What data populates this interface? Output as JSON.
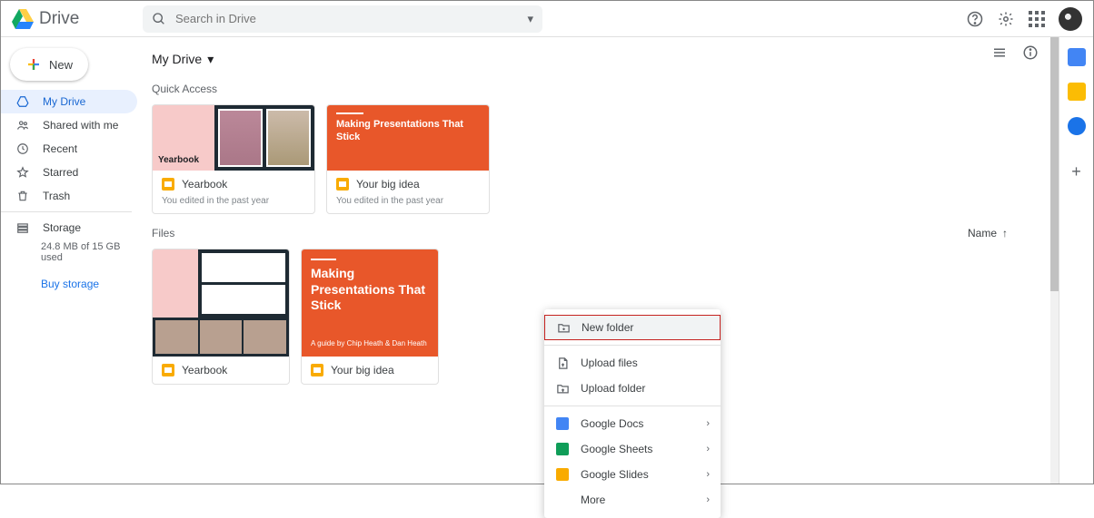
{
  "header": {
    "app_name": "Drive",
    "search_placeholder": "Search in Drive"
  },
  "sidebar": {
    "new_label": "New",
    "items": [
      {
        "label": "My Drive",
        "icon": "my-drive"
      },
      {
        "label": "Shared with me",
        "icon": "shared"
      },
      {
        "label": "Recent",
        "icon": "recent"
      },
      {
        "label": "Starred",
        "icon": "star"
      },
      {
        "label": "Trash",
        "icon": "trash"
      }
    ],
    "storage_label": "Storage",
    "storage_usage": "24.8 MB of 15 GB used",
    "buy_label": "Buy storage"
  },
  "breadcrumb": {
    "title": "My Drive"
  },
  "quick_access": {
    "title": "Quick Access",
    "cards": [
      {
        "name": "Yearbook",
        "thumb_label": "Yearbook",
        "meta": "You edited in the past year"
      },
      {
        "name": "Your big idea",
        "thumb_title": "Making Presentations That Stick",
        "meta": "You edited in the past year"
      }
    ]
  },
  "files": {
    "title": "Files",
    "sort_label": "Name",
    "items": [
      {
        "name": "Yearbook"
      },
      {
        "name": "Your big idea",
        "thumb_title": "Making Presentations That Stick",
        "thumb_sub": "A guide by Chip Heath & Dan Heath"
      }
    ]
  },
  "context_menu": {
    "new_folder": "New folder",
    "upload_files": "Upload files",
    "upload_folder": "Upload folder",
    "google_docs": "Google Docs",
    "google_sheets": "Google Sheets",
    "google_slides": "Google Slides",
    "more": "More"
  }
}
